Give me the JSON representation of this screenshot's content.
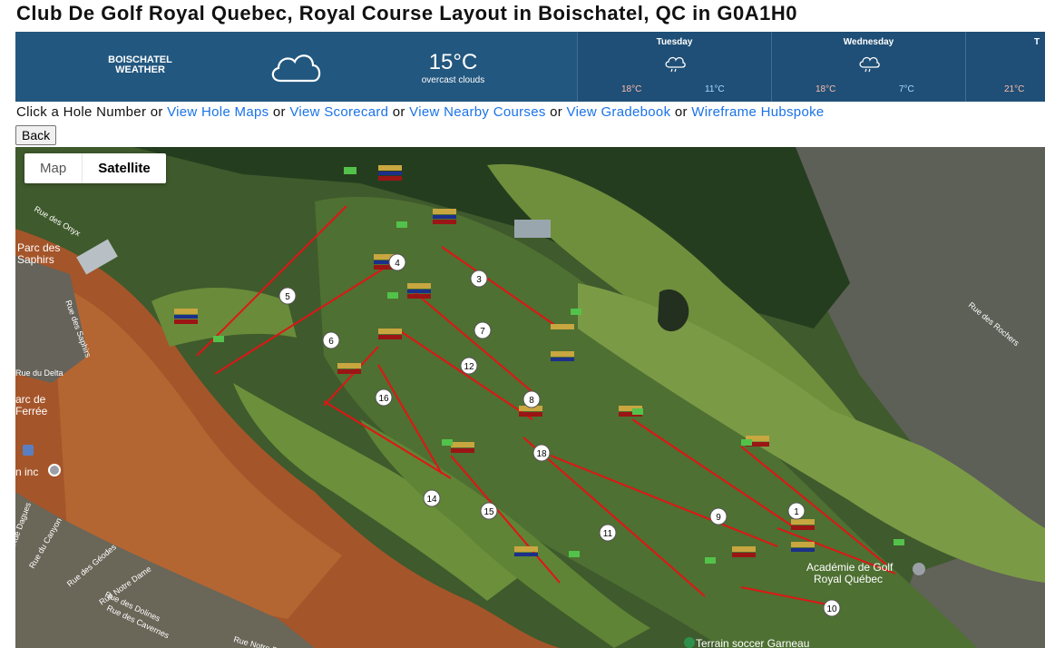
{
  "page_title": "Club De Golf Royal Quebec, Royal Course Layout in Boischatel, QC in G0A1H0",
  "weather": {
    "city_line1": "BOISCHATEL",
    "city_line2": "WEATHER",
    "icon": "cloud-icon",
    "temperature": "15°C",
    "condition": "overcast clouds",
    "forecast": [
      {
        "day": "Tuesday",
        "icon": "rain-cloud-icon",
        "high": "18°C",
        "low": "11°C"
      },
      {
        "day": "Wednesday",
        "icon": "rain-cloud-icon",
        "high": "18°C",
        "low": "7°C"
      },
      {
        "day": "T",
        "icon": "",
        "high": "21°C",
        "low": ""
      }
    ]
  },
  "nav": {
    "prefix": "Click a Hole Number or ",
    "sep": " or ",
    "links": [
      "View Hole Maps",
      "View Scorecard",
      "View Nearby Courses",
      "View Gradebook",
      "Wireframe Hubspoke"
    ]
  },
  "back_label": "Back",
  "map": {
    "type_buttons": [
      "Map",
      "Satellite"
    ],
    "selected_type": "Satellite",
    "hole_numbers": [
      "1",
      "3",
      "4",
      "5",
      "6",
      "7",
      "8",
      "9",
      "10",
      "11",
      "12",
      "14",
      "15",
      "16",
      "18"
    ],
    "place_labels": {
      "park_saphirs": [
        "Parc des",
        "Saphirs"
      ],
      "park_ferree": [
        "arc de",
        "Ferrée"
      ],
      "academie": [
        "Académie de Golf",
        "Royal Québec"
      ],
      "terrain": "Terrain soccer Garneau",
      "business": "n inc",
      "streets": [
        "Rue des Onyx",
        "Rue des Saphirs",
        "Rue du Delta",
        "Rue des Rochers",
        "Rue du Canyon",
        "Rue des Géodes",
        "Rue Notre Dame",
        "Rue des Dolines",
        "Rue des Cavernes",
        "Rue Notre Dame",
        "Rue Dagues"
      ]
    }
  }
}
